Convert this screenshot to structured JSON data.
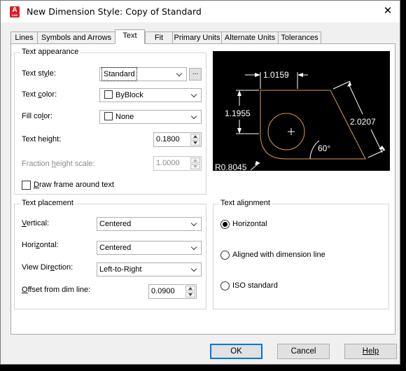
{
  "window": {
    "title": "New Dimension Style: Copy of Standard",
    "app_icon_letter": "A",
    "app_icon_caption": "CAD"
  },
  "tabs": [
    "Lines",
    "Symbols and Arrows",
    "Text",
    "Fit",
    "Primary Units",
    "Alternate Units",
    "Tolerances"
  ],
  "active_tab": "Text",
  "text_appearance": {
    "title": "Text appearance",
    "text_style": {
      "label": "Text style:",
      "value": "Standard",
      "browse_label": "..."
    },
    "text_color": {
      "label": "Text color:",
      "value": "ByBlock"
    },
    "fill_color": {
      "label": "Fill color:",
      "value": "None"
    },
    "text_height": {
      "label": "Text height:",
      "value": "0.1800"
    },
    "fraction_height_scale": {
      "label": "Fraction height scale:",
      "value": "1.0000"
    },
    "draw_frame": {
      "label": "Draw frame around text",
      "checked": false
    }
  },
  "preview": {
    "dim_top": "1.0159",
    "dim_left": "1.1955",
    "dim_diag": "2.0207",
    "angle": "60°",
    "radius": "R0.8045",
    "geometry_color": "#d8a040",
    "dim_color": "#ffffff"
  },
  "text_placement": {
    "title": "Text placement",
    "vertical": {
      "label": "Vertical:",
      "value": "Centered"
    },
    "horizontal": {
      "label": "Horizontal:",
      "value": "Centered"
    },
    "view_direction": {
      "label": "View Direction:",
      "value": "Left-to-Right"
    },
    "offset": {
      "label": "Offset from dim line:",
      "value": "0.0900"
    }
  },
  "text_alignment": {
    "title": "Text alignment",
    "options": [
      {
        "label": "Horizontal",
        "selected": true
      },
      {
        "label": "Aligned with dimension line",
        "selected": false
      },
      {
        "label": "ISO standard",
        "selected": false
      }
    ]
  },
  "buttons": {
    "ok": "OK",
    "cancel": "Cancel",
    "help": "Help"
  }
}
